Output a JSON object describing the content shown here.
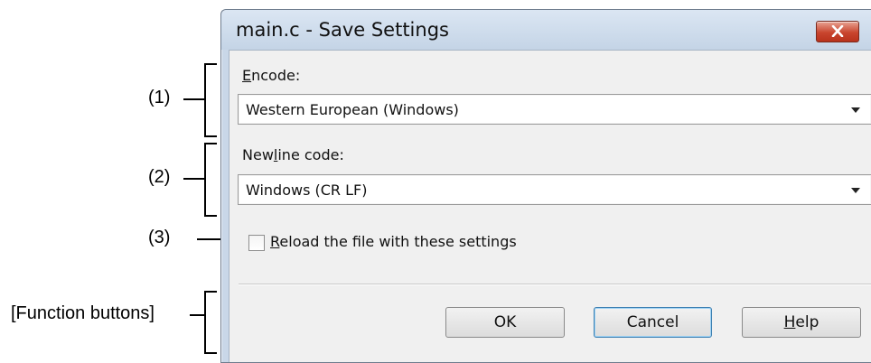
{
  "annotations": {
    "section1": "(1)",
    "section2": "(2)",
    "section3": "(3)",
    "function_buttons": "[Function buttons]"
  },
  "dialog": {
    "title": "main.c - Save Settings",
    "encode": {
      "label_mnemonic": "E",
      "label_rest": "ncode:",
      "value": "Western European (Windows)"
    },
    "newline": {
      "label_before": "New",
      "label_mnemonic": "l",
      "label_after": "ine code:",
      "value": "Windows (CR LF)"
    },
    "reload": {
      "label_mnemonic": "R",
      "label_rest": "eload the file with these settings",
      "checked": false
    },
    "buttons": {
      "ok": "OK",
      "cancel": "Cancel",
      "help_mnemonic": "H",
      "help_rest": "elp"
    }
  },
  "colors": {
    "titlebar": "#c9d7e8",
    "close_button": "#c9452e",
    "client_background": "#f0f0f0"
  }
}
